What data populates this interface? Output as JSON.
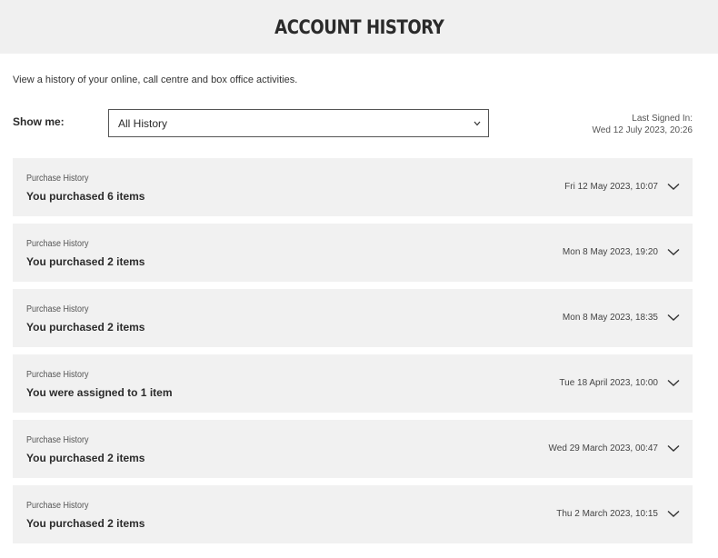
{
  "header": {
    "title": "ACCOUNT HISTORY"
  },
  "intro": {
    "text": "View a history of your online, call centre and box office activities."
  },
  "filter": {
    "label": "Show me:",
    "selected": "All History"
  },
  "last_signed": {
    "label": "Last Signed In:",
    "value": "Wed 12 July 2023, 20:26"
  },
  "history": [
    {
      "type": "Purchase History",
      "summary": "You purchased 6 items",
      "date": "Fri 12 May 2023, 10:07"
    },
    {
      "type": "Purchase History",
      "summary": "You purchased 2 items",
      "date": "Mon 8 May 2023, 19:20"
    },
    {
      "type": "Purchase History",
      "summary": "You purchased 2 items",
      "date": "Mon 8 May 2023, 18:35"
    },
    {
      "type": "Purchase History",
      "summary": "You were assigned to 1 item",
      "date": "Tue 18 April 2023, 10:00"
    },
    {
      "type": "Purchase History",
      "summary": "You purchased 2 items",
      "date": "Wed 29 March 2023, 00:47"
    },
    {
      "type": "Purchase History",
      "summary": "You purchased 2 items",
      "date": "Thu 2 March 2023, 10:15"
    }
  ],
  "icons": {
    "select": "chevron-down-icon",
    "expand": "chevron-down-icon"
  },
  "colors": {
    "header_bg": "#f0f0f0",
    "item_bg": "#f1f1f1",
    "text": "#2b2b2b"
  }
}
